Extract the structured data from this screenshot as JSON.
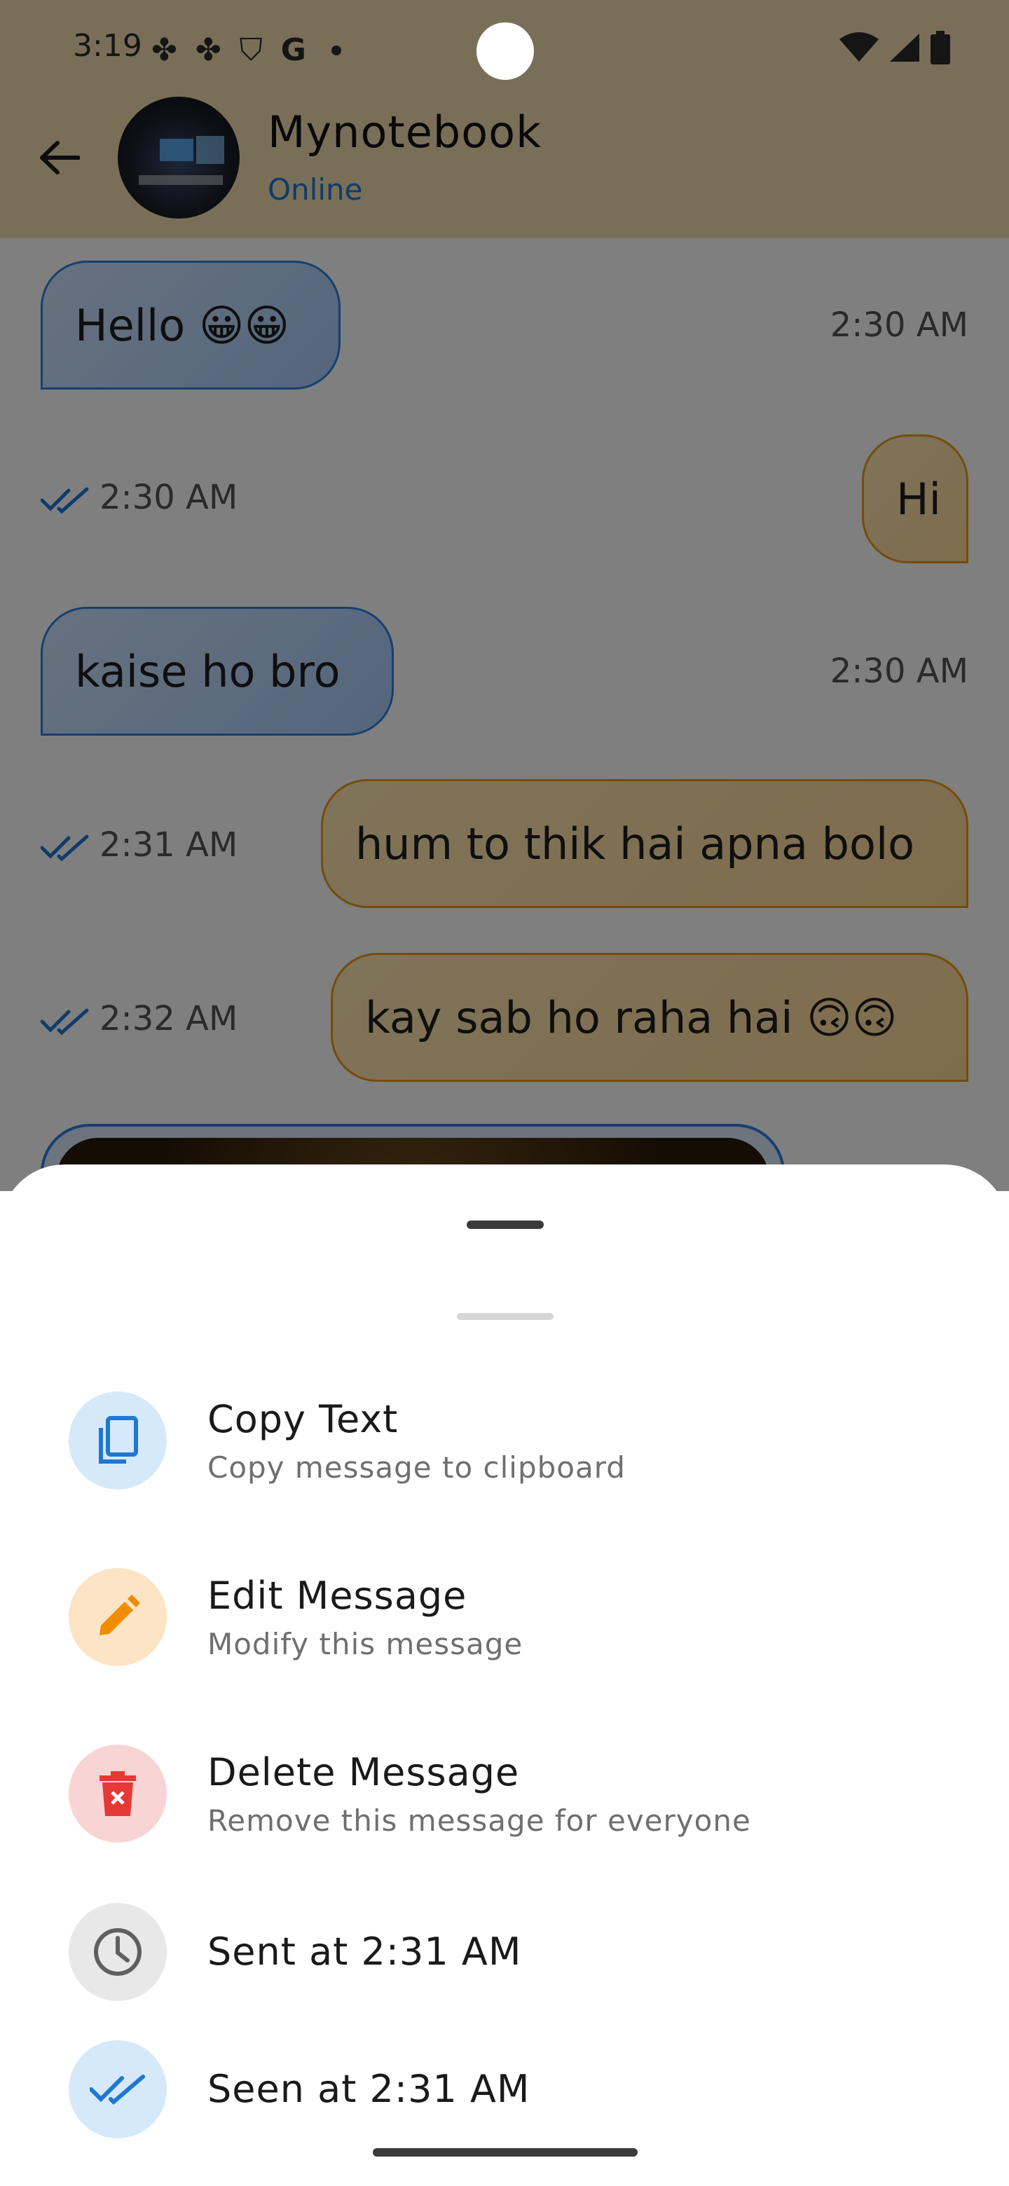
{
  "status_bar": {
    "time": "3:19",
    "left_icons": [
      "fan-icon",
      "fan-icon",
      "shield-icon",
      "google-icon"
    ],
    "right_icons": [
      "wifi-icon",
      "signal-icon",
      "battery-icon"
    ]
  },
  "header": {
    "contact_name": "Mynotebook",
    "contact_status": "Online"
  },
  "messages": [
    {
      "text": "Hello 😀😀",
      "time": "2:30 AM",
      "direction": "incoming"
    },
    {
      "text": "Hi",
      "time": "2:30 AM",
      "direction": "outgoing"
    },
    {
      "text": "kaise ho bro",
      "time": "2:30 AM",
      "direction": "incoming"
    },
    {
      "text": "hum to thik hai apna bolo",
      "time": "2:31 AM",
      "direction": "outgoing"
    },
    {
      "text": "kay sab ho raha hai 🙃🙃",
      "time": "2:32 AM",
      "direction": "outgoing"
    }
  ],
  "sheet": {
    "copy": {
      "title": "Copy Text",
      "subtitle": "Copy message to clipboard"
    },
    "edit": {
      "title": "Edit Message",
      "subtitle": "Modify this message"
    },
    "delete": {
      "title": "Delete Message",
      "subtitle": "Remove this message for everyone"
    },
    "sent": {
      "title": "Sent at 2:31 AM"
    },
    "seen": {
      "title": "Seen at 2:31 AM"
    }
  },
  "colors": {
    "incoming_border": "#2f7fe0",
    "outgoing_border": "#e79a16",
    "online": "#1f77d2",
    "ticks": "#1f77d2",
    "copy_bg": "#d6e9fb",
    "edit_bg": "#fde4c4",
    "delete_bg": "#f9d4d4",
    "sent_bg": "#e8e8e8",
    "seen_bg": "#d6e9fb"
  }
}
